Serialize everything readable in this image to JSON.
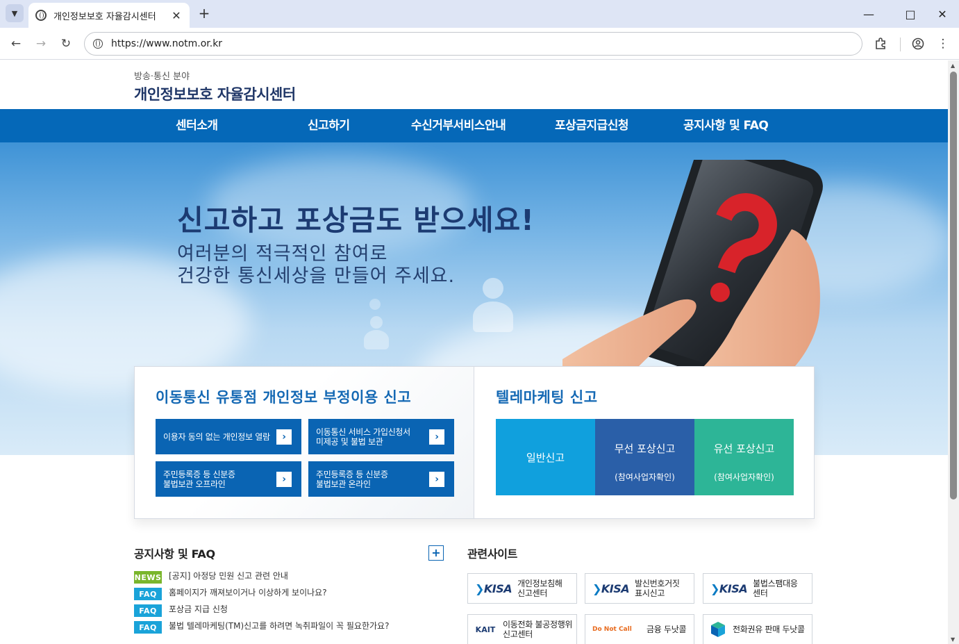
{
  "browser": {
    "tab_title": "개인정보보호 자율감시센터",
    "url": "https://www.notm.or.kr"
  },
  "site": {
    "subtitle": "방송·통신 분야",
    "title": "개인정보보호 자율감시센터"
  },
  "nav": [
    "센터소개",
    "신고하기",
    "수신거부서비스안내",
    "포상금지급신청",
    "공지사항 및 FAQ"
  ],
  "hero": {
    "headline": "신고하고 포상금도 받으세요!",
    "line1": "여러분의 적극적인 참여로",
    "line2": "건강한 통신세상을 만들어 주세요."
  },
  "mobile_report": {
    "title": "이동통신 유통점 개인정보 부정이용 신고",
    "buttons": [
      {
        "line1": "이용자 동의 없는 개인정보 열람",
        "line2": ""
      },
      {
        "line1": "이동통신 서비스 가입신청서",
        "line2": "미제공 및 불법 보관"
      },
      {
        "line1": "주민등록증 등 신분증",
        "line2": "불법보관 오프라인"
      },
      {
        "line1": "주민등록증 등 신분증",
        "line2": "불법보관 온라인"
      }
    ]
  },
  "tm_report": {
    "title": "텔레마케팅 신고",
    "buttons": [
      {
        "label": "일반신고",
        "sub": "",
        "color": "#10a0dd"
      },
      {
        "label": "무선 포상신고",
        "sub": "(참여사업자확인)",
        "color": "#2a5fa8"
      },
      {
        "label": "유선 포상신고",
        "sub": "(참여사업자확인)",
        "color": "#2db597"
      }
    ]
  },
  "notices": {
    "title": "공지사항 및 FAQ",
    "items": [
      {
        "badge": "NEWS",
        "badge_color": "#7ab62c",
        "text": "[공지] 아정당 민원 신고 관련 안내"
      },
      {
        "badge": "FAQ",
        "badge_color": "#1aa3d9",
        "text": "홈페이지가 깨져보이거나 이상하게 보이나요?"
      },
      {
        "badge": "FAQ",
        "badge_color": "#1aa3d9",
        "text": "포상금 지급 신청"
      },
      {
        "badge": "FAQ",
        "badge_color": "#1aa3d9",
        "text": "불법 텔레마케팅(TM)신고를 하려면 녹취파일이 꼭 필요한가요?"
      }
    ]
  },
  "related": {
    "title": "관련사이트",
    "sites": [
      {
        "logo": "KISA",
        "line1": "개인정보침해",
        "line2": "신고센터"
      },
      {
        "logo": "KISA",
        "line1": "발신번호거짓",
        "line2": "표시신고"
      },
      {
        "logo": "KISA",
        "line1": "불법스팸대응",
        "line2": "센터"
      },
      {
        "logo": "KAIT",
        "line1": "이동전화 불공정행위",
        "line2": "신고센터"
      },
      {
        "logo": "Do Not Call",
        "line1": "금융 두낫콜",
        "line2": ""
      },
      {
        "logo": "",
        "line1": "전화권유 판매 두낫콜",
        "line2": ""
      }
    ]
  },
  "colors": {
    "nav_bg": "#0568b8",
    "brand_blue": "#1569b4"
  }
}
